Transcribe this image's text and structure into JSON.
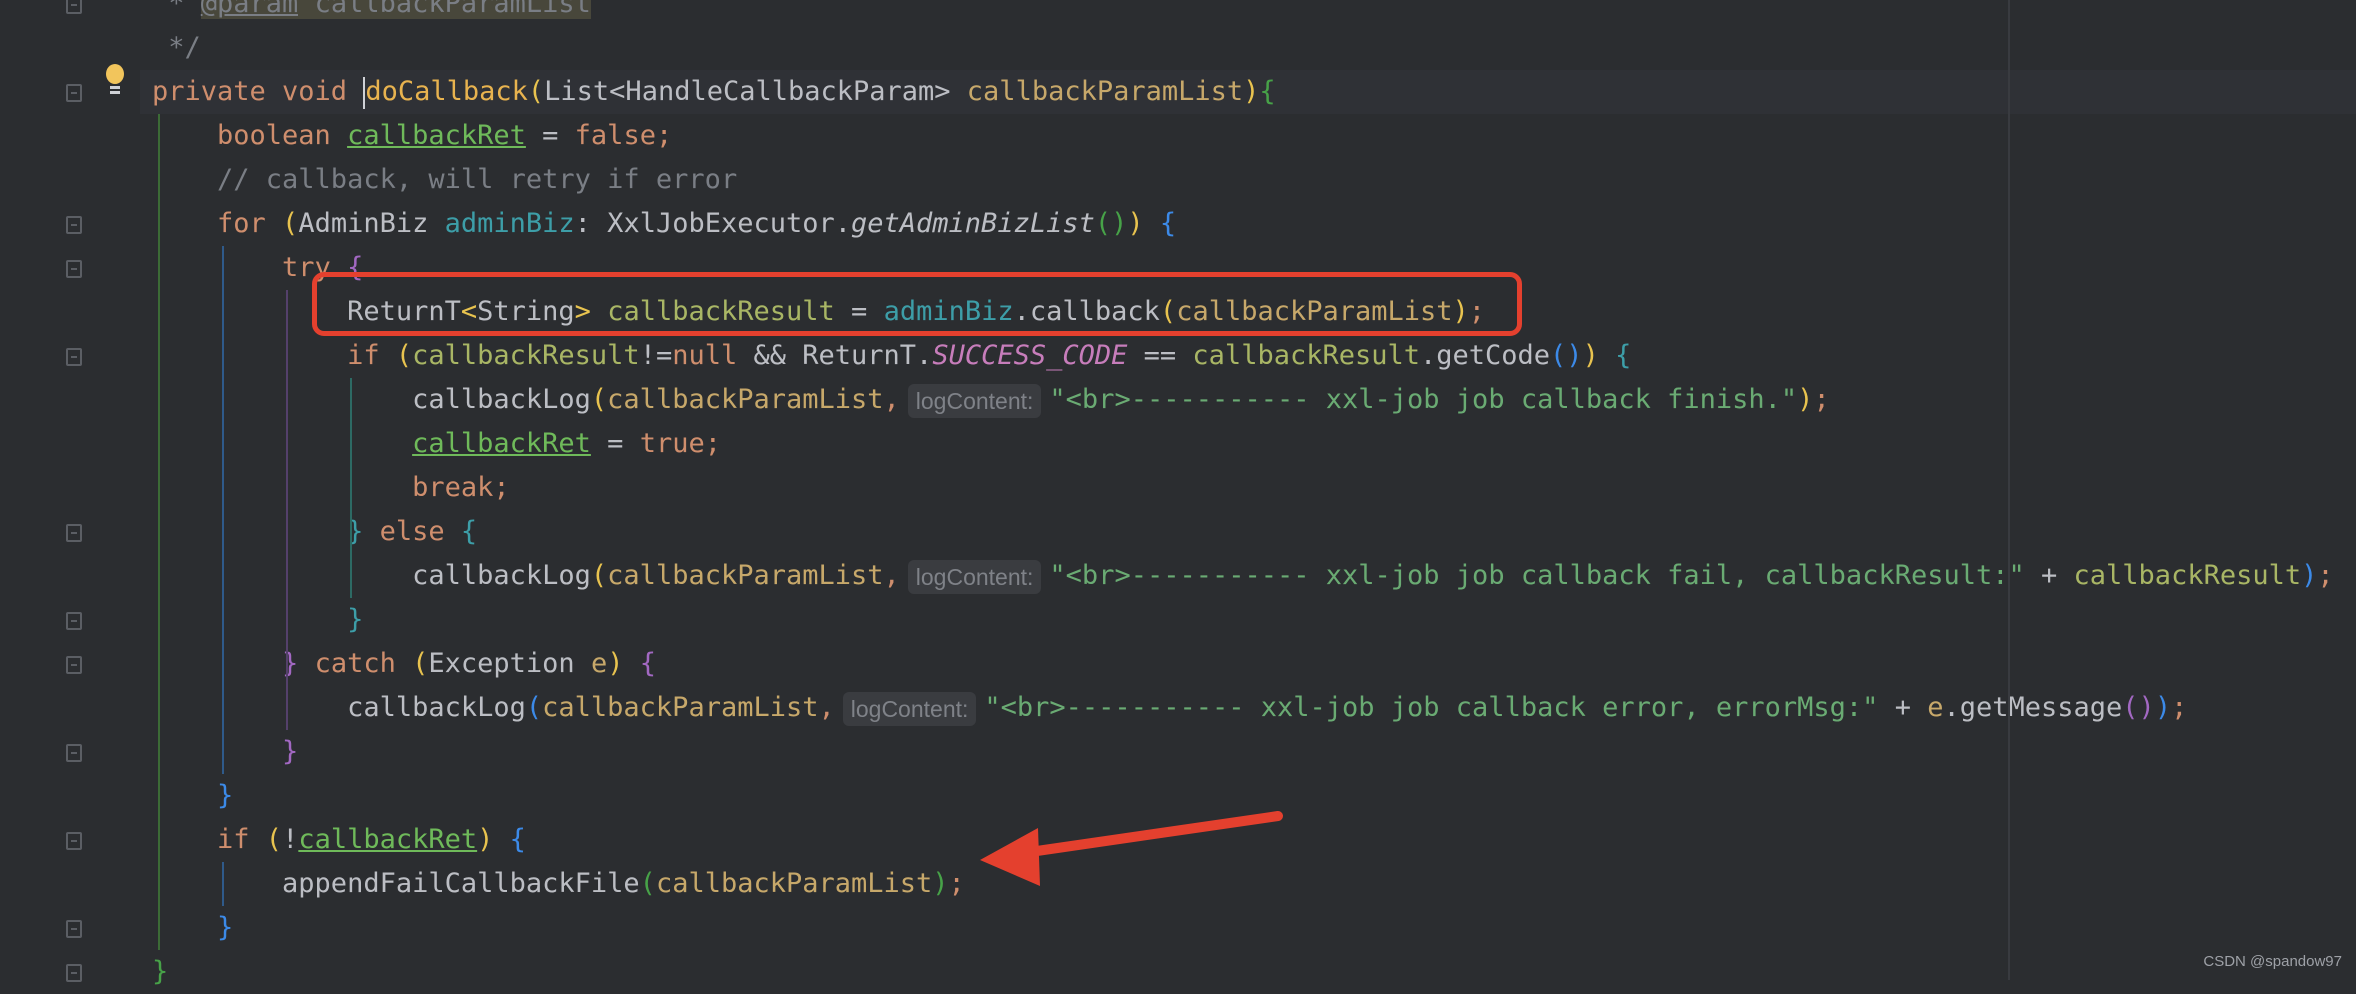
{
  "editor": {
    "lines": [
      {
        "segments": [
          {
            "t": " * ",
            "c": "comment"
          },
          {
            "t": "@param",
            "c": "ann ann-bg"
          },
          {
            "t": " ",
            "c": "ann-bg"
          },
          {
            "t": "callbackParamList",
            "c": "ann-bg"
          }
        ]
      },
      {
        "segments": [
          {
            "t": " */",
            "c": "comment"
          }
        ]
      },
      {
        "segments": [
          {
            "t": "private void ",
            "c": "kw"
          },
          {
            "t": "|",
            "c": "caret"
          },
          {
            "t": "doCallback",
            "c": "fn-decl"
          },
          {
            "t": "(",
            "c": "paren-y"
          },
          {
            "t": "List<HandleCallbackParam> ",
            "c": ""
          },
          {
            "t": "callbackParamList",
            "c": "param"
          },
          {
            "t": ")",
            "c": "paren-y"
          },
          {
            "t": "{",
            "c": "paren-g"
          }
        ]
      },
      {
        "segments": [
          {
            "t": "    boolean ",
            "c": "kw"
          },
          {
            "t": "callbackRet",
            "c": "var-mut"
          },
          {
            "t": " = ",
            "c": ""
          },
          {
            "t": "false",
            "c": "kw"
          },
          {
            "t": ";",
            "c": "kw"
          }
        ]
      },
      {
        "segments": [
          {
            "t": "    // callback, will retry if error",
            "c": "comment"
          }
        ]
      },
      {
        "segments": [
          {
            "t": "    for ",
            "c": "kw"
          },
          {
            "t": "(",
            "c": "paren-y"
          },
          {
            "t": "AdminBiz ",
            "c": ""
          },
          {
            "t": "adminBiz",
            "c": "var-field"
          },
          {
            "t": ": XxlJobExecutor.",
            "c": ""
          },
          {
            "t": "getAdminBizList",
            "c": "italic-fn"
          },
          {
            "t": "()",
            "c": "paren-g"
          },
          {
            "t": ")",
            "c": "paren-y"
          },
          {
            "t": " ",
            "c": ""
          },
          {
            "t": "{",
            "c": "paren-b"
          }
        ]
      },
      {
        "segments": [
          {
            "t": "        try ",
            "c": "kw"
          },
          {
            "t": "{",
            "c": "paren-p"
          }
        ]
      },
      {
        "segments": [
          {
            "t": "            ReturnT",
            "c": ""
          },
          {
            "t": "<",
            "c": "paren-y"
          },
          {
            "t": "String",
            "c": ""
          },
          {
            "t": ">",
            "c": "paren-y"
          },
          {
            "t": " ",
            "c": ""
          },
          {
            "t": "callbackResult",
            "c": "var-local"
          },
          {
            "t": " = ",
            "c": ""
          },
          {
            "t": "adminBiz",
            "c": "var-field"
          },
          {
            "t": ".callback",
            "c": ""
          },
          {
            "t": "(",
            "c": "paren-y"
          },
          {
            "t": "callbackParamList",
            "c": "param"
          },
          {
            "t": ")",
            "c": "paren-y"
          },
          {
            "t": ";",
            "c": "kw"
          }
        ]
      },
      {
        "segments": [
          {
            "t": "            if ",
            "c": "kw"
          },
          {
            "t": "(",
            "c": "paren-y"
          },
          {
            "t": "callbackResult",
            "c": "var-local"
          },
          {
            "t": "!=",
            "c": ""
          },
          {
            "t": "null",
            "c": "kw"
          },
          {
            "t": " && ReturnT.",
            "c": ""
          },
          {
            "t": "SUCCESS_CODE",
            "c": "static"
          },
          {
            "t": " == ",
            "c": ""
          },
          {
            "t": "callbackResult",
            "c": "var-local"
          },
          {
            "t": ".getCode",
            "c": ""
          },
          {
            "t": "()",
            "c": "paren-b"
          },
          {
            "t": ")",
            "c": "paren-y"
          },
          {
            "t": " ",
            "c": ""
          },
          {
            "t": "{",
            "c": "var-field"
          }
        ]
      },
      {
        "segments": [
          {
            "t": "                callbackLog",
            "c": ""
          },
          {
            "t": "(",
            "c": "paren-y"
          },
          {
            "t": "callbackParamList",
            "c": "param"
          },
          {
            "t": ",",
            "c": "kw"
          },
          {
            "t": "logContent:",
            "c": "hint"
          },
          {
            "t": "\"<br>----------- xxl-job job callback finish.\"",
            "c": "str"
          },
          {
            "t": ")",
            "c": "paren-y"
          },
          {
            "t": ";",
            "c": "kw"
          }
        ]
      },
      {
        "segments": [
          {
            "t": "                ",
            "c": ""
          },
          {
            "t": "callbackRet",
            "c": "var-mut"
          },
          {
            "t": " = ",
            "c": ""
          },
          {
            "t": "true",
            "c": "kw"
          },
          {
            "t": ";",
            "c": "kw"
          }
        ]
      },
      {
        "segments": [
          {
            "t": "                break",
            "c": "kw"
          },
          {
            "t": ";",
            "c": "kw"
          }
        ]
      },
      {
        "segments": [
          {
            "t": "            ",
            "c": ""
          },
          {
            "t": "}",
            "c": "var-field"
          },
          {
            "t": " else ",
            "c": "kw"
          },
          {
            "t": "{",
            "c": "var-field"
          }
        ]
      },
      {
        "segments": [
          {
            "t": "                callbackLog",
            "c": ""
          },
          {
            "t": "(",
            "c": "paren-y"
          },
          {
            "t": "callbackParamList",
            "c": "param"
          },
          {
            "t": ",",
            "c": "kw"
          },
          {
            "t": "logContent:",
            "c": "hint"
          },
          {
            "t": "\"<br>----------- xxl-job job callback fail, callbackResult:\"",
            "c": "str"
          },
          {
            "t": " + ",
            "c": ""
          },
          {
            "t": "callbackResult",
            "c": "var-local"
          },
          {
            "t": ")",
            "c": "paren-b"
          },
          {
            "t": ";",
            "c": "kw"
          }
        ]
      },
      {
        "segments": [
          {
            "t": "            ",
            "c": ""
          },
          {
            "t": "}",
            "c": "var-field"
          }
        ]
      },
      {
        "segments": [
          {
            "t": "        ",
            "c": ""
          },
          {
            "t": "}",
            "c": "paren-p"
          },
          {
            "t": " catch ",
            "c": "kw"
          },
          {
            "t": "(",
            "c": "paren-y"
          },
          {
            "t": "Exception ",
            "c": ""
          },
          {
            "t": "e",
            "c": "param"
          },
          {
            "t": ")",
            "c": "paren-y"
          },
          {
            "t": " ",
            "c": ""
          },
          {
            "t": "{",
            "c": "paren-p"
          }
        ]
      },
      {
        "segments": [
          {
            "t": "            callbackLog",
            "c": ""
          },
          {
            "t": "(",
            "c": "paren-b"
          },
          {
            "t": "callbackParamList",
            "c": "param"
          },
          {
            "t": ",",
            "c": "kw"
          },
          {
            "t": "logContent:",
            "c": "hint"
          },
          {
            "t": "\"<br>----------- xxl-job job callback error, errorMsg:\"",
            "c": "str"
          },
          {
            "t": " + ",
            "c": ""
          },
          {
            "t": "e",
            "c": "param"
          },
          {
            "t": ".getMessage",
            "c": ""
          },
          {
            "t": "()",
            "c": "paren-p"
          },
          {
            "t": ")",
            "c": "paren-b"
          },
          {
            "t": ";",
            "c": "kw"
          }
        ]
      },
      {
        "segments": [
          {
            "t": "        ",
            "c": ""
          },
          {
            "t": "}",
            "c": "paren-p"
          }
        ]
      },
      {
        "segments": [
          {
            "t": "    ",
            "c": ""
          },
          {
            "t": "}",
            "c": "paren-b"
          }
        ]
      },
      {
        "segments": [
          {
            "t": "    if ",
            "c": "kw"
          },
          {
            "t": "(",
            "c": "paren-y"
          },
          {
            "t": "!",
            "c": ""
          },
          {
            "t": "callbackRet",
            "c": "var-mut"
          },
          {
            "t": ")",
            "c": "paren-y"
          },
          {
            "t": " ",
            "c": ""
          },
          {
            "t": "{",
            "c": "paren-b"
          }
        ]
      },
      {
        "segments": [
          {
            "t": "        appendFailCallbackFile",
            "c": ""
          },
          {
            "t": "(",
            "c": "paren-g"
          },
          {
            "t": "callbackParamList",
            "c": "param"
          },
          {
            "t": ")",
            "c": "paren-g"
          },
          {
            "t": ";",
            "c": "kw"
          }
        ]
      },
      {
        "segments": [
          {
            "t": "    ",
            "c": ""
          },
          {
            "t": "}",
            "c": "paren-b"
          }
        ]
      },
      {
        "segments": [
          {
            "t": "}",
            "c": "paren-g"
          }
        ]
      }
    ]
  },
  "icons": {
    "intention_bulb": "lightbulb-icon",
    "fold": "fold-marker-icon"
  },
  "annotations": {
    "highlight_color": "#e4402e",
    "arrow_color": "#e4402e"
  },
  "watermark": "CSDN @spandow97"
}
